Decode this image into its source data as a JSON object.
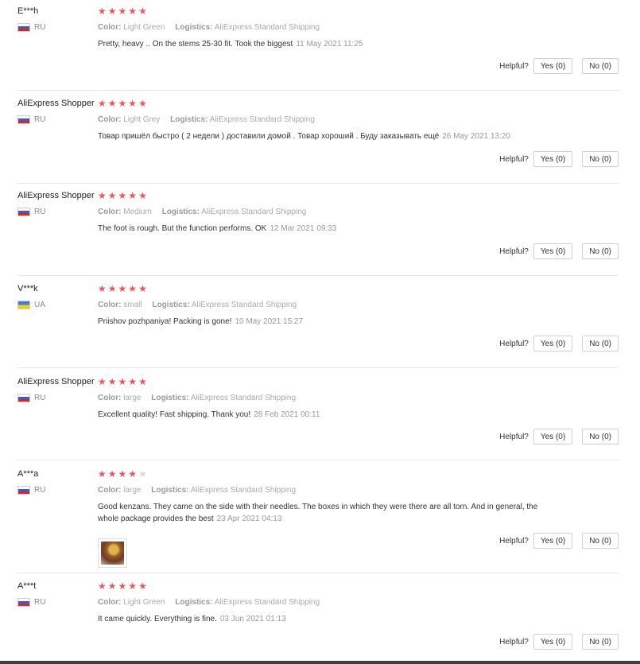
{
  "helpful_label": "Helpful?",
  "color_label": "Color:",
  "logistics_label": "Logistics:",
  "reviews": [
    {
      "user": "E***h",
      "country": "RU",
      "flag": "ru",
      "stars": 5,
      "color": "Light Green",
      "logistics": "AliExpress Standard Shipping",
      "text": "Pretty, heavy .. On the stems 25-30 fit. Took the biggest",
      "date": "11 May 2021 11:25",
      "yes": "Yes (0)",
      "no": "No (0)"
    },
    {
      "user": "AliExpress Shopper",
      "country": "RU",
      "flag": "ru",
      "stars": 5,
      "color": "Light Grey",
      "logistics": "AliExpress Standard Shipping",
      "text": "Товар пришёл быстро ( 2 недели ) доставили домой . Товар хороший . Буду заказывать ещё",
      "date": "26 May 2021 13:20",
      "yes": "Yes (0)",
      "no": "No (0)"
    },
    {
      "user": "AliExpress Shopper",
      "country": "RU",
      "flag": "ru",
      "stars": 5,
      "color": "Medium",
      "logistics": "AliExpress Standard Shipping",
      "text": "The foot is rough. But the function performs. OK",
      "date": "12 Mar 2021 09:33",
      "yes": "Yes (0)",
      "no": "No (0)"
    },
    {
      "user": "V***k",
      "country": "UA",
      "flag": "ua",
      "stars": 5,
      "color": "small",
      "logistics": "AliExpress Standard Shipping",
      "text": "Priishov pozhpaniya! Packing is gone!",
      "date": "10 May 2021 15:27",
      "yes": "Yes (0)",
      "no": "No (0)"
    },
    {
      "user": "AliExpress Shopper",
      "country": "RU",
      "flag": "ru",
      "stars": 5,
      "color": "large",
      "logistics": "AliExpress Standard Shipping",
      "text": "Excellent quality! Fast shipping. Thank you!",
      "date": "28 Feb 2021 00:11",
      "yes": "Yes (0)",
      "no": "No (0)"
    },
    {
      "user": "A***a",
      "country": "RU",
      "flag": "ru",
      "stars": 4,
      "color": "large",
      "logistics": "AliExpress Standard Shipping",
      "text": "Good kenzans. They came on the side with their needles. The boxes in which they were there are all torn. And in general, the whole package provides the best",
      "date": "23 Apr 2021 04:13",
      "yes": "Yes (0)",
      "no": "No (0)",
      "has_photo": true
    },
    {
      "user": "A***t",
      "country": "RU",
      "flag": "ru",
      "stars": 5,
      "color": "Light Green",
      "logistics": "AliExpress Standard Shipping",
      "text": "It came quickly. Everything is fine.",
      "date": "03 Jun 2021 01:13",
      "yes": "Yes (0)",
      "no": "No (0)"
    }
  ]
}
